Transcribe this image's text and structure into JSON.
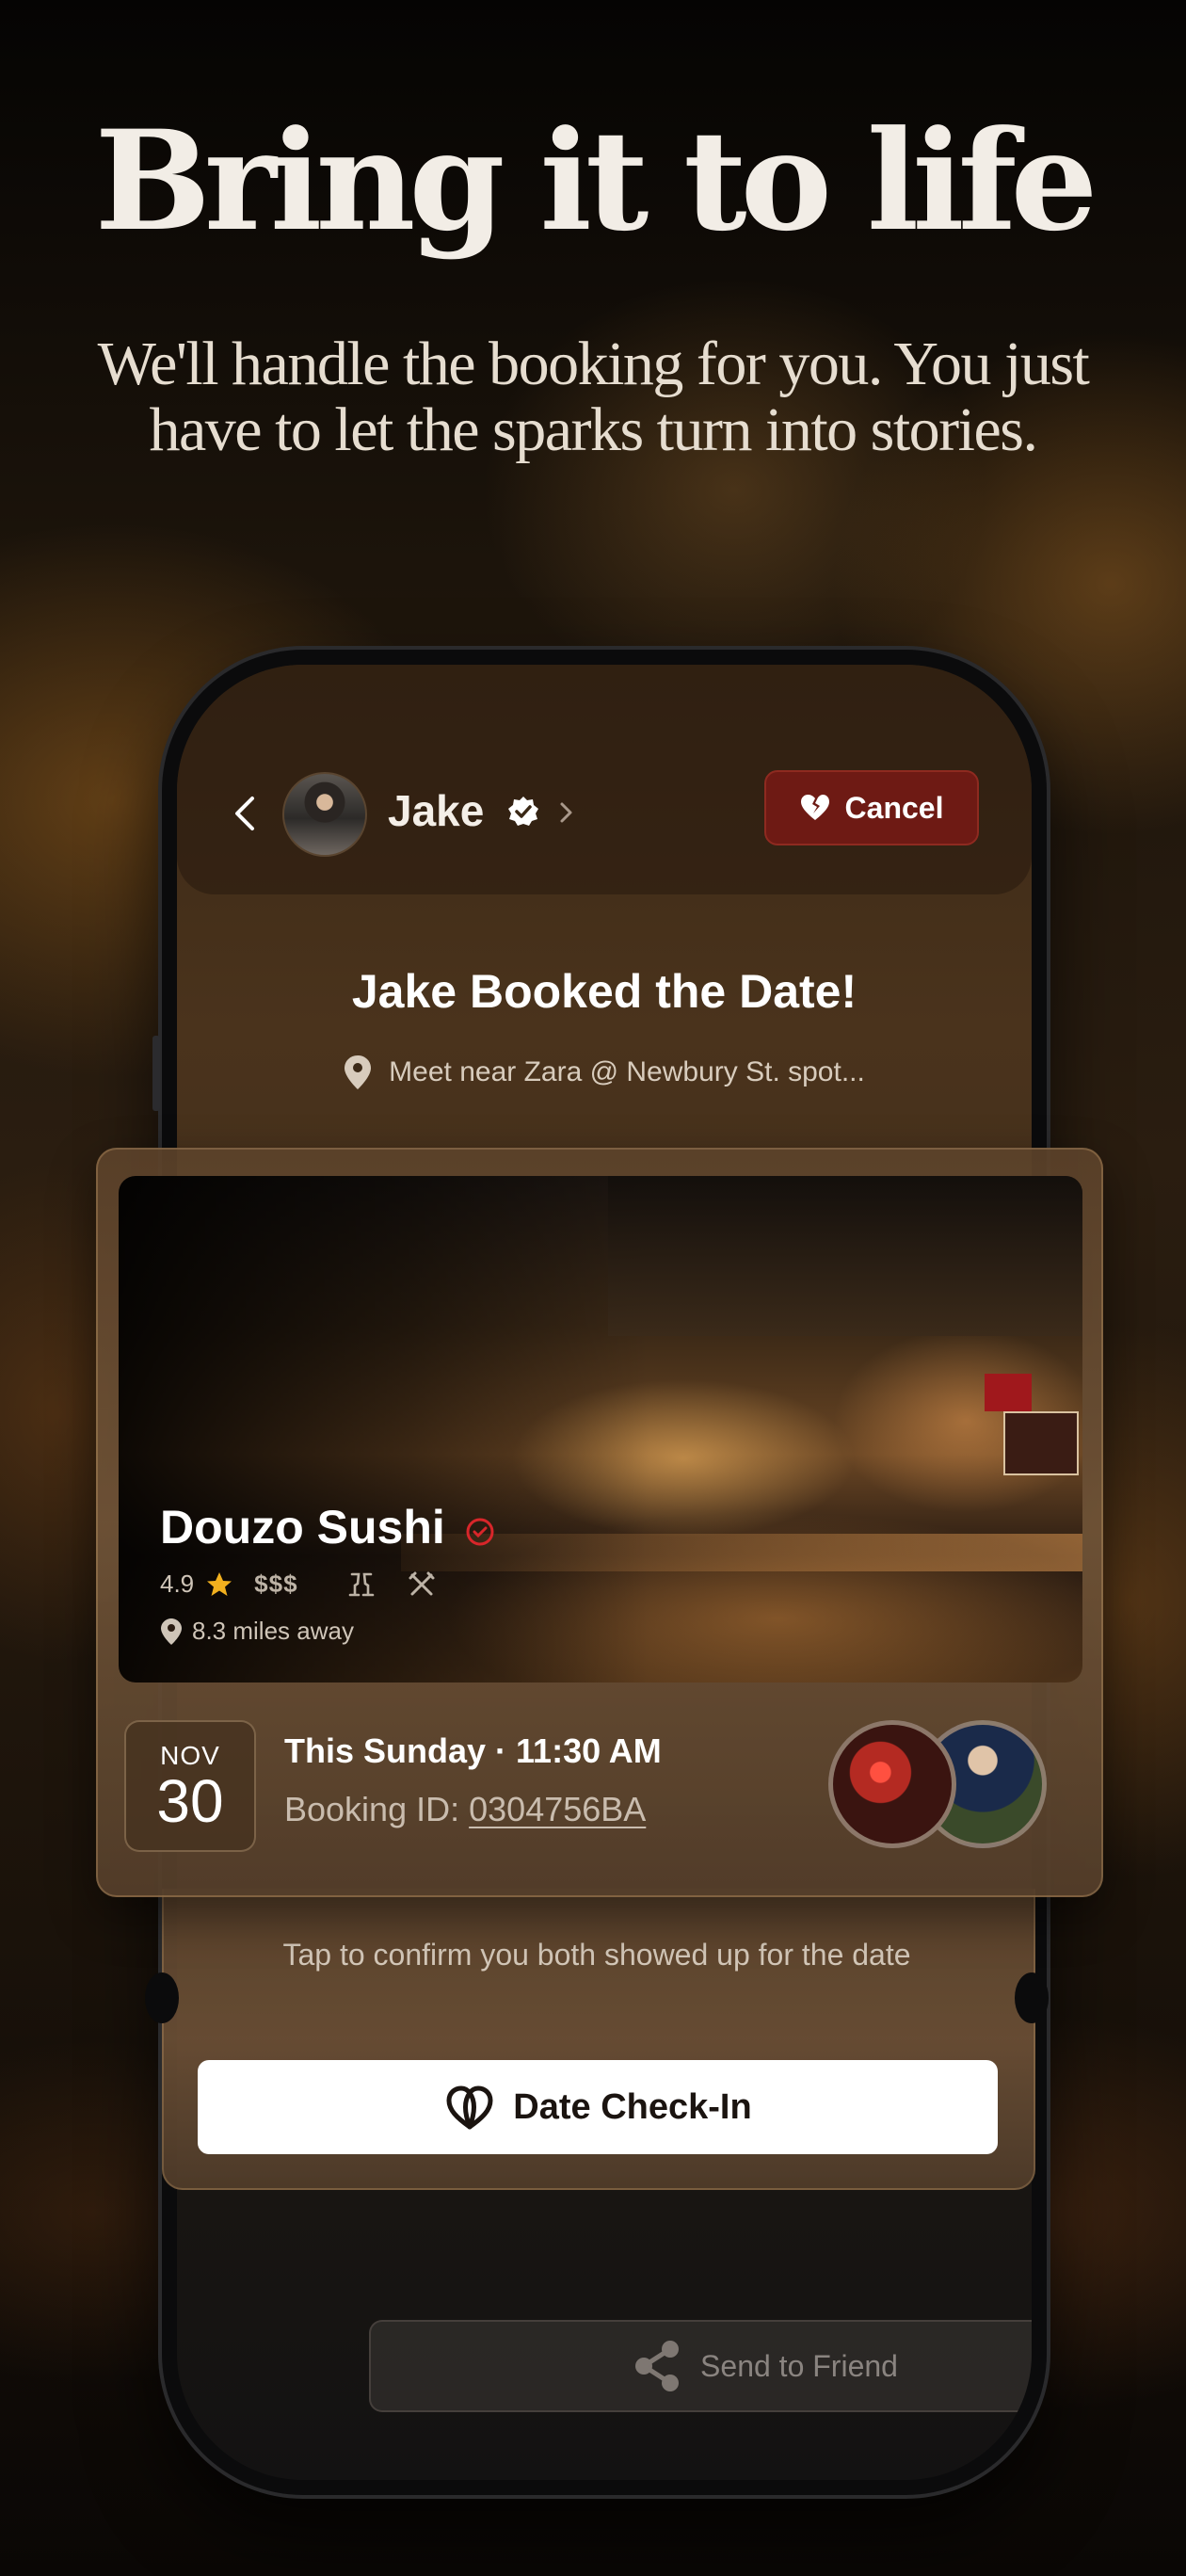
{
  "promo": {
    "headline": "Bring it to life",
    "subline": "We'll handle the booking for you. You just have to let the sparks turn into stories."
  },
  "header": {
    "name": "Jake",
    "cancel_label": "Cancel",
    "icons": [
      "back-chevron",
      "avatar",
      "verified-badge",
      "chevron-right",
      "broken-heart"
    ]
  },
  "booking": {
    "title": "Jake Booked the Date!",
    "meet_location": "Meet near Zara @ Newbury St. spot...",
    "venue": {
      "name": "Douzo Sushi",
      "rating": "4.9",
      "price": "$$$",
      "distance": "8.3 miles away"
    },
    "date": {
      "month": "NOV",
      "day": "30",
      "when": "This Sunday · 11:30 AM",
      "booking_id_label": "Booking ID:",
      "booking_id": "0304756BA"
    },
    "confirm_hint": "Tap to confirm you both showed up for the date",
    "checkin_label": "Date Check-In",
    "send_label": "Send to Friend"
  },
  "colors": {
    "cancel_bg": "#6e1a14",
    "accent_star": "#f2b01e",
    "badge_red": "#d8262a"
  }
}
